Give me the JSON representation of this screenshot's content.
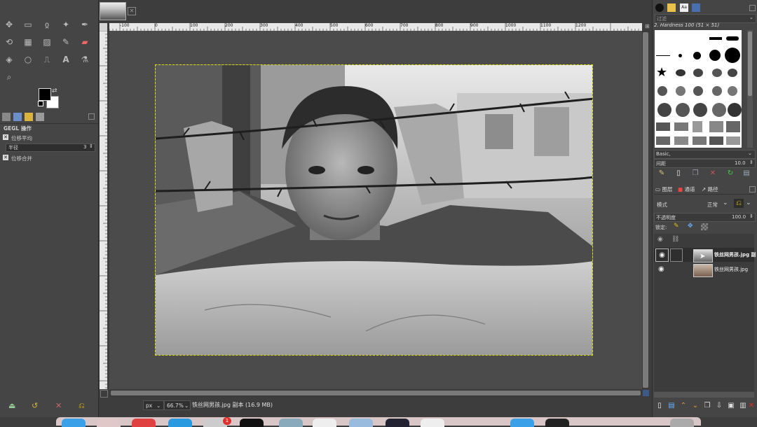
{
  "toolbox": {
    "tools": [
      "move-tool",
      "rect-select-tool",
      "lasso-tool",
      "fuzzy-select-tool",
      "paths-tool",
      "transform-tool",
      "crop-tool",
      "gradient-tool",
      "paintbrush-tool",
      "eraser-tool",
      "bucket-fill-tool",
      "heal-tool",
      "clone-tool",
      "text-tool",
      "color-picker-tool",
      "zoom-tool"
    ],
    "gegl_title": "GEGL 操作",
    "gegl_op1": "位移平均",
    "radius_label": "半径",
    "radius_value": "3",
    "gegl_op2": "位移合并"
  },
  "canvas": {
    "ruler_labels": [
      "-100",
      "0",
      "100",
      "200",
      "300",
      "400",
      "500",
      "600",
      "700",
      "800",
      "900",
      "1000",
      "1100",
      "1200"
    ]
  },
  "status": {
    "unit": "px",
    "zoom": "66.7%",
    "text": "铁丝网男孩.jpg 副本 (16.9 MB)"
  },
  "brushes": {
    "filter_label": "过滤",
    "title": "2. Hardness 100 (51 × 51)",
    "preset": "Basic,",
    "spacing_label": "间距",
    "spacing_value": "10.0"
  },
  "layers": {
    "tabs": [
      "图层",
      "通道",
      "路径"
    ],
    "mode_label": "模式",
    "mode_value": "正常",
    "opacity_label": "不透明度",
    "opacity_value": "100.0",
    "lock_label": "锁定:",
    "items": [
      {
        "name": "铁丝网男孩.jpg 副",
        "active": true
      },
      {
        "name": "铁丝网男孩.jpg",
        "active": false
      }
    ]
  },
  "colors": {
    "selection": "#e3e100",
    "notification": "#e0302a"
  },
  "mac_dock": {
    "badge": "1"
  }
}
